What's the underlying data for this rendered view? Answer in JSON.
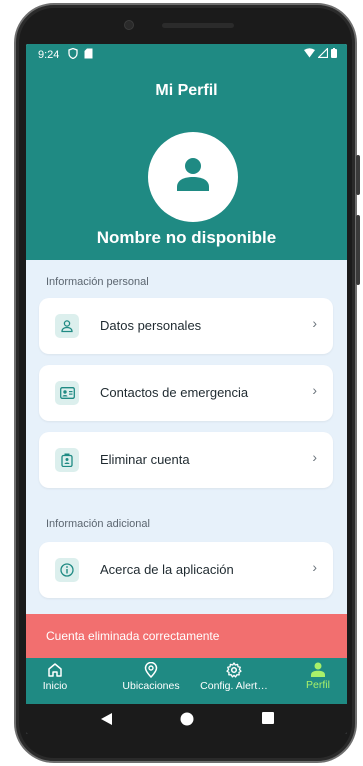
{
  "status_bar": {
    "time": "9:24"
  },
  "header": {
    "title": "Mi Perfil",
    "user_name": "Nombre no disponible"
  },
  "sections": {
    "personal": {
      "label": "Información personal",
      "items": [
        {
          "label": "Datos personales",
          "icon": "person-icon"
        },
        {
          "label": "Contactos de emergencia",
          "icon": "contact-card-icon"
        },
        {
          "label": "Eliminar cuenta",
          "icon": "delete-account-icon"
        }
      ]
    },
    "additional": {
      "label": "Información adicional",
      "items": [
        {
          "label": "Acerca de la aplicación",
          "icon": "info-icon"
        }
      ]
    }
  },
  "snackbar": {
    "message": "Cuenta eliminada correctamente"
  },
  "bottom_nav": {
    "items": [
      {
        "label": "Inicio",
        "icon": "home-icon"
      },
      {
        "label": "Ubicaciones",
        "icon": "location-pin-icon"
      },
      {
        "label": "Config. Alert…",
        "icon": "gear-icon"
      },
      {
        "label": "Perfil",
        "icon": "person-icon"
      }
    ],
    "active_index": 3
  },
  "colors": {
    "primary": "#1f8a83",
    "background": "#e7f1fa",
    "snackbar": "#f26f6f",
    "active_nav": "#a8f06a"
  }
}
